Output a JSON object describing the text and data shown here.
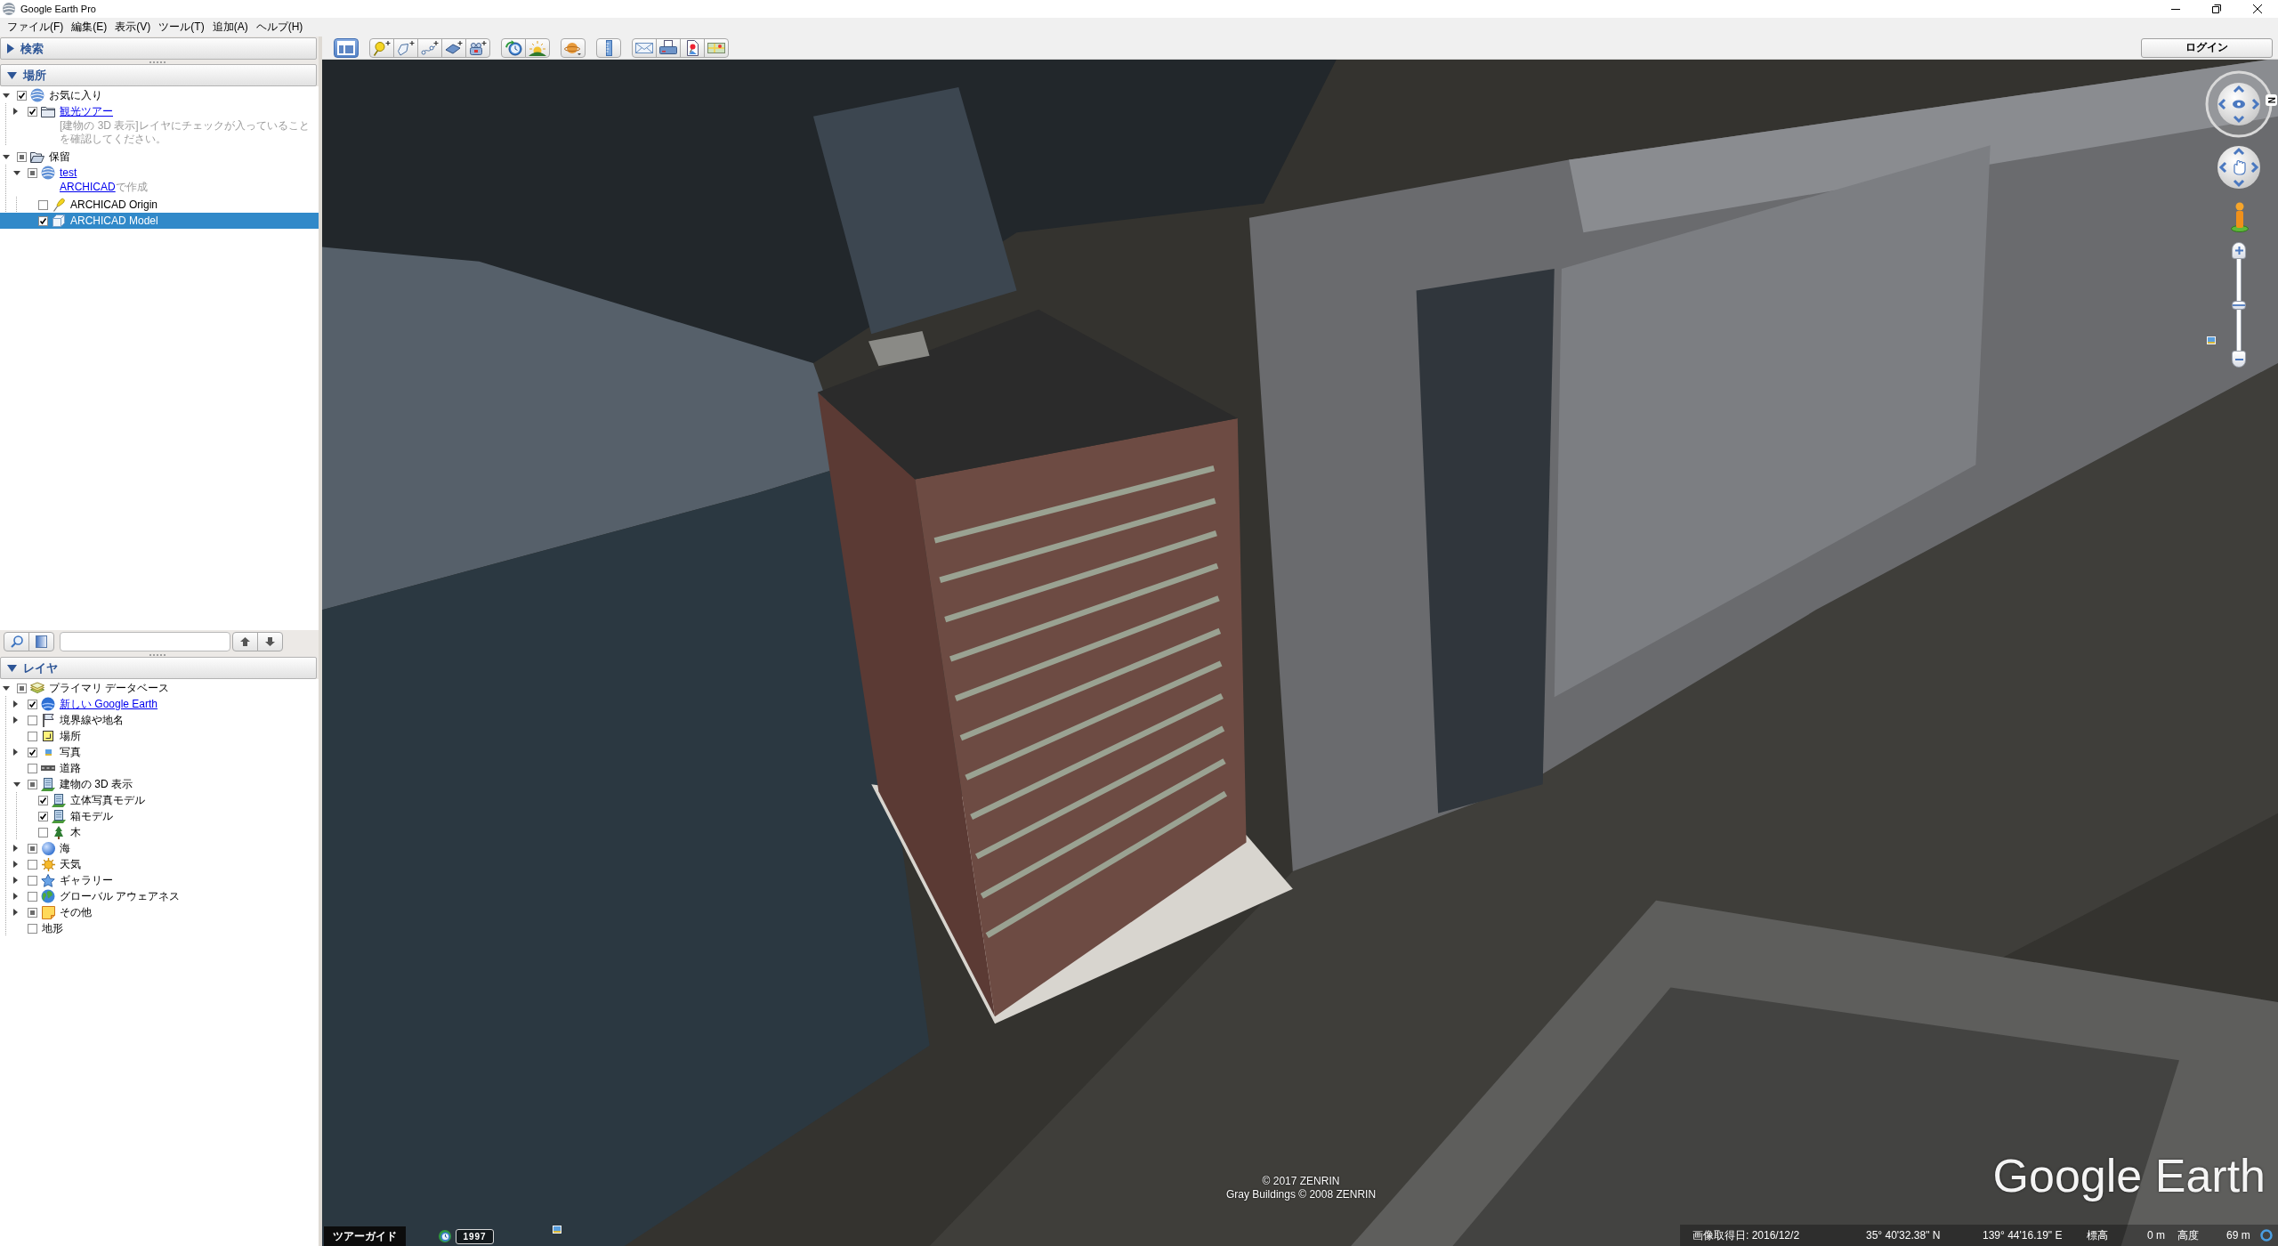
{
  "window": {
    "title": "Google Earth Pro"
  },
  "menu": [
    "ファイル(F)",
    "編集(E)",
    "表示(V)",
    "ツール(T)",
    "追加(A)",
    "ヘルプ(H)"
  ],
  "search_panel": {
    "title": "検索",
    "expanded": false
  },
  "places": {
    "title": "場所",
    "expanded": true,
    "items": [
      {
        "label": "お気に入り",
        "kind": "document",
        "checked": true,
        "partial": false,
        "expanded": true,
        "link": false,
        "selected": false,
        "children": [
          {
            "label": "観光ツアー",
            "kind": "folder",
            "checked": true,
            "partial": false,
            "expanded": false,
            "link": true,
            "selected": false,
            "description": {
              "text": "[建物の 3D 表示]レイヤにチェックが入っていることを確認してください。"
            }
          }
        ]
      },
      {
        "label": "保留",
        "kind": "folder",
        "checked": false,
        "partial": true,
        "expanded": true,
        "link": false,
        "selected": false,
        "children": [
          {
            "label": "test",
            "kind": "document",
            "checked": false,
            "partial": true,
            "expanded": true,
            "link": true,
            "selected": false,
            "description": {
              "link": "ARCHICAD",
              "text": "で作成"
            },
            "children": [
              {
                "label": "ARCHICAD Origin",
                "kind": "placemark",
                "checked": false,
                "partial": false,
                "link": false,
                "selected": false
              },
              {
                "label": "ARCHICAD Model",
                "kind": "model",
                "checked": true,
                "partial": false,
                "link": false,
                "selected": true
              }
            ]
          }
        ]
      }
    ]
  },
  "layers": {
    "title": "レイヤ",
    "expanded": true,
    "items": [
      {
        "label": "プライマリ データベース",
        "kind": "database",
        "checked": false,
        "partial": true,
        "expanded": true,
        "link": false,
        "children": [
          {
            "label": "新しい Google Earth",
            "kind": "earth",
            "checked": true,
            "partial": false,
            "expanded": false,
            "link": true
          },
          {
            "label": "境界線や地名",
            "kind": "borders",
            "checked": false,
            "partial": false,
            "expanded": false,
            "link": false
          },
          {
            "label": "場所",
            "kind": "places",
            "checked": false,
            "partial": false,
            "link": false
          },
          {
            "label": "写真",
            "kind": "photos",
            "checked": true,
            "partial": false,
            "expanded": false,
            "link": false
          },
          {
            "label": "道路",
            "kind": "roads",
            "checked": false,
            "partial": false,
            "link": false
          },
          {
            "label": "建物の 3D 表示",
            "kind": "buildings",
            "checked": false,
            "partial": true,
            "expanded": true,
            "link": false,
            "children": [
              {
                "label": "立体写真モデル",
                "kind": "buildings",
                "checked": true,
                "partial": false,
                "link": false
              },
              {
                "label": "箱モデル",
                "kind": "buildings",
                "checked": true,
                "partial": false,
                "link": false
              },
              {
                "label": "木",
                "kind": "trees",
                "checked": false,
                "partial": false,
                "link": false
              }
            ]
          },
          {
            "label": "海",
            "kind": "ocean",
            "checked": false,
            "partial": true,
            "expanded": false,
            "link": false
          },
          {
            "label": "天気",
            "kind": "weather",
            "checked": false,
            "partial": false,
            "expanded": false,
            "link": false
          },
          {
            "label": "ギャラリー",
            "kind": "gallery",
            "checked": false,
            "partial": false,
            "expanded": false,
            "link": false
          },
          {
            "label": "グローバル アウェアネス",
            "kind": "awareness",
            "checked": false,
            "partial": false,
            "expanded": false,
            "link": false
          },
          {
            "label": "その他",
            "kind": "more",
            "checked": false,
            "partial": true,
            "expanded": false,
            "link": false
          },
          {
            "label": "地形",
            "kind": "terrain",
            "checked": false,
            "partial": false,
            "link": false
          }
        ]
      }
    ]
  },
  "toolbar": {
    "sidebar_on": true,
    "login": "ログイン"
  },
  "map": {
    "north_label": "N",
    "zoom_slider": {
      "level": 0.5
    },
    "tour_guide": "ツアーガイド",
    "imagery_year": "1997",
    "copyright": [
      "© 2017 ZENRIN",
      "Gray Buildings © 2008 ZENRIN"
    ],
    "logo": "Google Earth",
    "status": {
      "imagery_date": "画像取得日: 2016/12/2",
      "latitude": "35° 40'32.38\" N",
      "longitude": "139° 44'16.19\" E",
      "elevation_label": "標高",
      "elevation": "0 m",
      "altitude_label": "高度",
      "altitude": "69 m"
    }
  }
}
